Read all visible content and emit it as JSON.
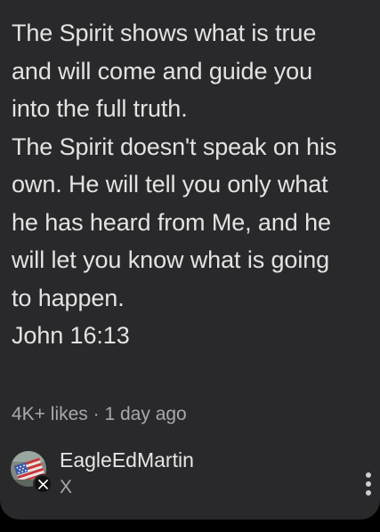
{
  "post": {
    "lines": [
      "The Spirit shows what is true",
      "and will come and guide you",
      "into the full truth.",
      "The Spirit doesn't speak on his",
      "own. He will tell you only what",
      "he has heard from Me, and he",
      "will let you know what is going",
      "to happen.",
      "John 16:13"
    ],
    "likes": "4K+ likes",
    "separator": "·",
    "time": "1 day ago"
  },
  "author": {
    "name": "EagleEdMartin",
    "source": "X",
    "platform_icon": "x-logo-icon",
    "avatar": "american-flag-avatar"
  },
  "actions": {
    "more_icon": "more-vertical-icon"
  },
  "colors": {
    "card_background": "#29292b",
    "page_background": "#000000",
    "text_primary": "#e3e3e3",
    "text_secondary": "#a9a9ab"
  }
}
